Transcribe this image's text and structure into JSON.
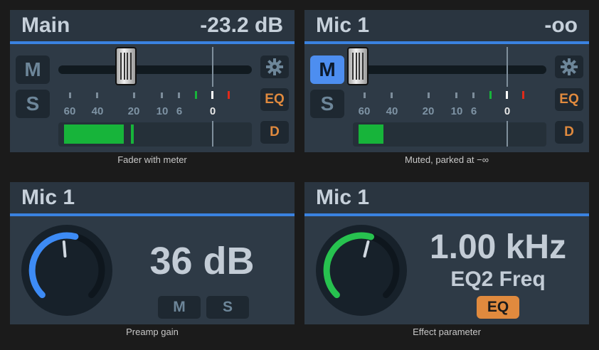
{
  "panels": [
    {
      "title": "Main",
      "value": "-23.2 dB",
      "mute_label": "M",
      "solo_label": "S",
      "eq_label": "EQ",
      "d_label": "D",
      "meter_level": 0.31,
      "caption": "Fader with meter"
    },
    {
      "title": "Mic 1",
      "value": "-oo",
      "mute_label": "M",
      "solo_label": "S",
      "eq_label": "EQ",
      "d_label": "D",
      "meter_level": 0.13,
      "caption": "Muted, parked at −∞"
    },
    {
      "title": "Mic 1",
      "value": "36 dB",
      "mute_label": "M",
      "solo_label": "S",
      "caption": "Preamp gain"
    },
    {
      "title": "Mic 1",
      "value": "1.00 kHz",
      "param_name": "EQ2 Freq",
      "eq_label": "EQ",
      "caption": "Effect parameter"
    }
  ],
  "scale_labels": [
    "60",
    "40",
    "20",
    "10",
    "6",
    "0"
  ],
  "colors": {
    "accent": "#3a82e0",
    "mute_active": "#4d8ef0",
    "meter_green": "#17b43a",
    "orange": "#e08a3e",
    "knob_blue": "#3d8bf5",
    "knob_green": "#27c24f"
  },
  "icons": [
    "gear-icon"
  ]
}
